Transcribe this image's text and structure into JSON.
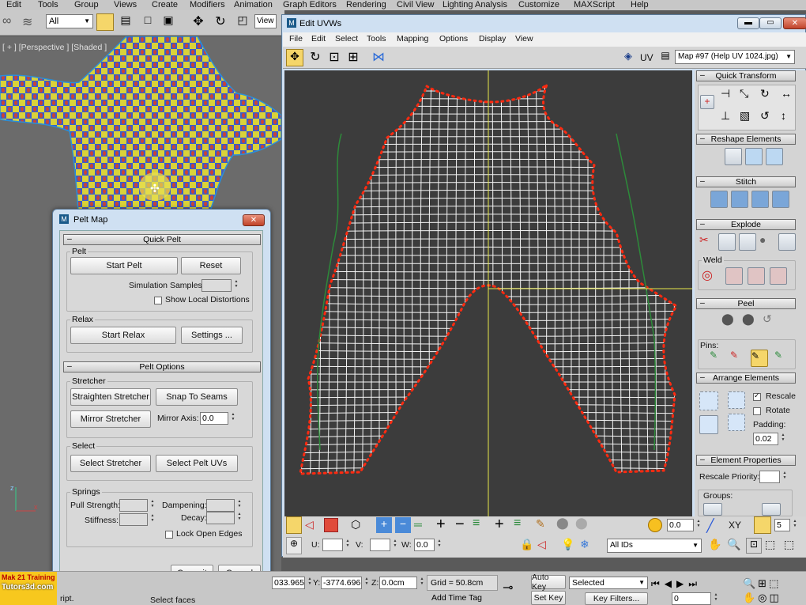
{
  "main_menu": [
    "Edit",
    "Tools",
    "Group",
    "Views",
    "Create",
    "Modifiers",
    "Animation",
    "Graph Editors",
    "Rendering",
    "Civil View",
    "Lighting Analysis",
    "Customize",
    "MAXScript",
    "Help"
  ],
  "toolbar": {
    "selection_filter": "All",
    "view_label": "View"
  },
  "viewport": {
    "label": "[ + ] [Perspective ] [Shaded ]"
  },
  "pelt_map": {
    "title": "Pelt Map",
    "quick_pelt": "Quick Pelt",
    "pelt_group": "Pelt",
    "start_pelt": "Start Pelt",
    "reset": "Reset",
    "simulation_samples": "Simulation Samples:",
    "show_local_distortions": "Show Local Distortions",
    "relax_group": "Relax",
    "start_relax": "Start Relax",
    "settings": "Settings ...",
    "pelt_options": "Pelt Options",
    "stretcher_group": "Stretcher",
    "straighten_stretcher": "Straighten Stretcher",
    "snap_to_seams": "Snap To Seams",
    "mirror_stretcher": "Mirror Stretcher",
    "mirror_axis": "Mirror Axis:",
    "mirror_axis_value": "0.0",
    "select_group": "Select",
    "select_stretcher": "Select Stretcher",
    "select_pelt_uvs": "Select Pelt UVs",
    "springs_group": "Springs",
    "pull_strength": "Pull Strength:",
    "dampening": "Dampening:",
    "stiffness": "Stiffness:",
    "decay": "Decay:",
    "lock_open_edges": "Lock Open Edges",
    "commit": "Commit",
    "cancel": "Cancel"
  },
  "edit_uvws": {
    "title": "Edit UVWs",
    "menu": [
      "File",
      "Edit",
      "Select",
      "Tools",
      "Mapping",
      "Options",
      "Display",
      "View"
    ],
    "uv_label": "UV",
    "map_select": "Map #97 (Help UV 1024.jpg)",
    "quick_transform": "Quick Transform",
    "reshape_elements": "Reshape Elements",
    "stitch": "Stitch",
    "explode": "Explode",
    "weld": "Weld",
    "peel": "Peel",
    "pins": "Pins:",
    "arrange_elements": "Arrange Elements",
    "rescale": "Rescale",
    "rotate": "Rotate",
    "padding": "Padding:",
    "padding_value": "0.02",
    "element_properties": "Element Properties",
    "rescale_priority": "Rescale Priority:",
    "groups": "Groups:",
    "bottom_value": "0.0",
    "xy_label": "XY",
    "grid_count": "5",
    "u_label": "U:",
    "v_label": "V:",
    "w_label": "W:",
    "w_value": "0.0",
    "ids_select": "All IDs"
  },
  "status": {
    "x_value": "033.965",
    "y_label": "Y:",
    "y_value": "-3774.696",
    "z_label": "Z:",
    "z_value": "0.0cm",
    "grid": "Grid = 50.8cm",
    "add_time_tag": "Add Time Tag",
    "auto_key": "Auto Key",
    "set_key": "Set Key",
    "selected": "Selected",
    "key_filters": "Key Filters...",
    "frame": "0",
    "prompt": "Select faces",
    "script_label": "ript."
  },
  "watermark": {
    "line1": "Mak 21 Training",
    "line2": "Tutors3d.com"
  },
  "colors": {
    "uv_bg": "#3c3c3c",
    "seam": "#ff2a10",
    "mesh": "#ffffff",
    "axis": "#e8e84a",
    "panel": "#d4d4d4"
  }
}
